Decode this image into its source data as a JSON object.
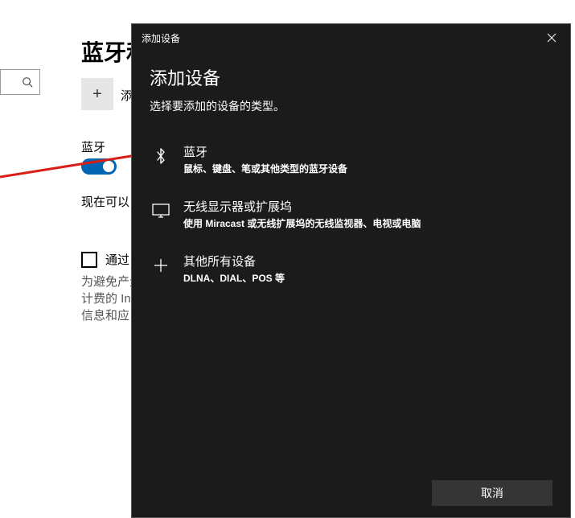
{
  "background": {
    "page_title_partial": "蓝牙和",
    "add_button_symbol": "+",
    "add_button_label": "添",
    "bluetooth_label": "蓝牙",
    "toggle_on": true,
    "now_available_partial": "现在可以",
    "checkbox_label": "通过",
    "warning_lines": [
      "为避免产生",
      "计费的 Int",
      "信息和应"
    ]
  },
  "arrow": {
    "color": "#d91e18"
  },
  "modal": {
    "header_title": "添加设备",
    "title": "添加设备",
    "subtitle": "选择要添加的设备的类型。",
    "options": [
      {
        "icon": "bluetooth-icon",
        "title": "蓝牙",
        "desc": "鼠标、键盘、笔或其他类型的蓝牙设备"
      },
      {
        "icon": "display-icon",
        "title": "无线显示器或扩展坞",
        "desc": "使用 Miracast 或无线扩展坞的无线监视器、电视或电脑"
      },
      {
        "icon": "plus-icon",
        "title": "其他所有设备",
        "desc": "DLNA、DIAL、POS 等"
      }
    ],
    "cancel_label": "取消"
  }
}
